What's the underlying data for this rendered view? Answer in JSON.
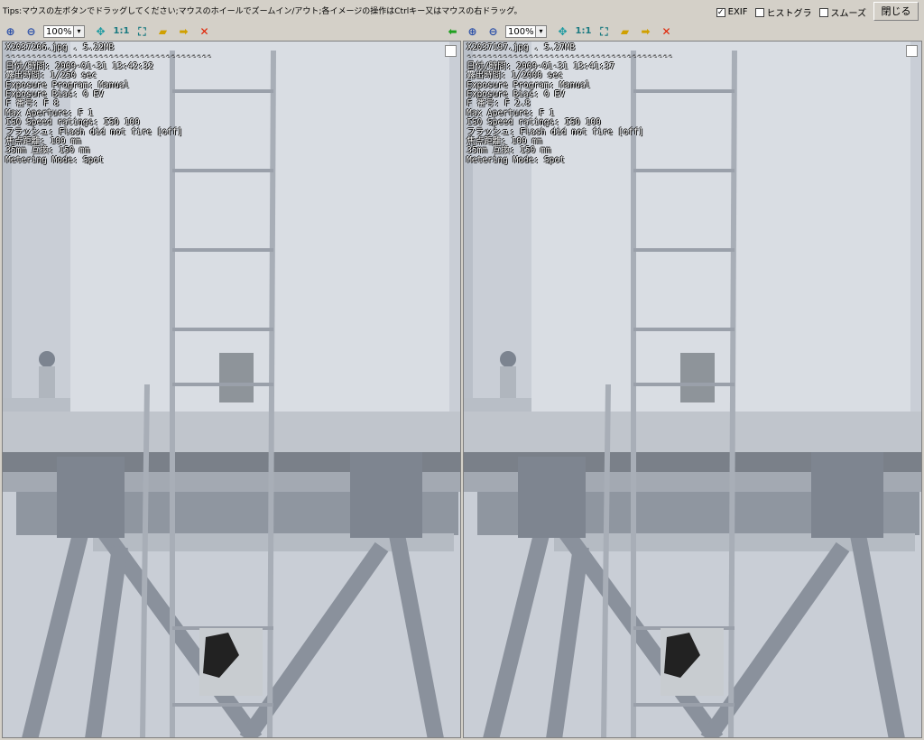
{
  "tips": "Tips:マウスの左ボタンでドラッグしてください;マウスのホイールでズームイン/アウト;各イメージの操作はCtrlキー又はマウスの右ドラッグ。",
  "options": [
    {
      "label": "EXIF",
      "checked": true
    },
    {
      "label": "ヒストグラ",
      "checked": false
    },
    {
      "label": "スムーズ",
      "checked": false
    }
  ],
  "close_label": "閉じる",
  "toolbar": {
    "zoom_value": "100%",
    "one_to_one": "1:1"
  },
  "panels": [
    {
      "filename": "X2037206.jpg",
      "size": "5.22MB",
      "separator": "----------------------------------------",
      "exif": [
        "日付/時間: 2009-01-31 13:42:32",
        "露出時間: 1/250 sec",
        "Exposure Program: Manual",
        "Exposure Bias: 0 EV",
        "F 番号: F 8",
        "Max Aperture: F 1",
        "ISO Speed ratings: ISO 100",
        "フラッシュ: Flash did not fire [off]",
        "焦点距離: 100 mm",
        "35mm 互換: 150 mm",
        "Metering Mode: Spot"
      ]
    },
    {
      "filename": "X2037197.jpg",
      "size": "5.27MB",
      "separator": "----------------------------------------",
      "exif": [
        "日付/時間: 2009-01-31 13:41:37",
        "露出時間: 1/2000 sec",
        "Exposure Program: Manual",
        "Exposure Bias: 0 EV",
        "F 番号: F 2.8",
        "Max Aperture: F 1",
        "ISO Speed ratings: ISO 100",
        "フラッシュ: Flash did not fire [off]",
        "焦点距離: 100 mm",
        "35mm 互換: 150 mm",
        "Metering Mode: Spot"
      ]
    }
  ]
}
